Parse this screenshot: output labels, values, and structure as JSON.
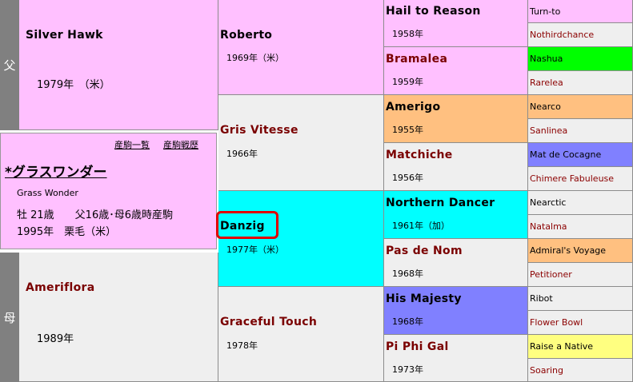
{
  "colors": {
    "pink": "#ffc0ff",
    "grey": "#efefef",
    "cyan": "#00ffff",
    "orange": "#ffc080",
    "blue": "#8080ff",
    "green": "#00ff00",
    "yellow": "#ffff80",
    "highlight": "#e00000"
  },
  "side_labels": {
    "sire": "父",
    "dam": "母"
  },
  "horse": {
    "links": {
      "offspring": "産駒一覧",
      "record": "産駒戦歴"
    },
    "name": "*グラスワンダー",
    "english": "Grass Wonder",
    "detail1": "牡 21歳　　父16歳･母6歳時産駒",
    "detail2": "1995年　栗毛（米）"
  },
  "gen1": {
    "sire": {
      "name": "Silver Hawk",
      "year": "1979年　（米）"
    },
    "dam": {
      "name": "Ameriflora",
      "year": "1989年"
    }
  },
  "gen2": [
    {
      "name": "Roberto",
      "year": "1969年（米）"
    },
    {
      "name": "Gris Vitesse",
      "year": "1966年"
    },
    {
      "name": "Danzig",
      "year": "1977年（米）"
    },
    {
      "name": "Graceful Touch",
      "year": "1978年"
    }
  ],
  "gen3": [
    {
      "name": "Hail to Reason",
      "year": "1958年"
    },
    {
      "name": "Bramalea",
      "year": "1959年"
    },
    {
      "name": "Amerigo",
      "year": "1955年"
    },
    {
      "name": "Matchiche",
      "year": "1956年"
    },
    {
      "name": "Northern Dancer",
      "year": "1961年（加）"
    },
    {
      "name": "Pas de Nom",
      "year": "1968年"
    },
    {
      "name": "His Majesty",
      "year": "1968年"
    },
    {
      "name": "Pi Phi Gal",
      "year": "1973年"
    }
  ],
  "gen4": [
    "Turn-to",
    "Nothirdchance",
    "Nashua",
    "Rarelea",
    "Nearco",
    "Sanlinea",
    "Mat de Cocagne",
    "Chimere Fabuleuse",
    "Nearctic",
    "Natalma",
    "Admiral's Voyage",
    "Petitioner",
    "Ribot",
    "Flower Bowl",
    "Raise a Native",
    "Soaring"
  ]
}
